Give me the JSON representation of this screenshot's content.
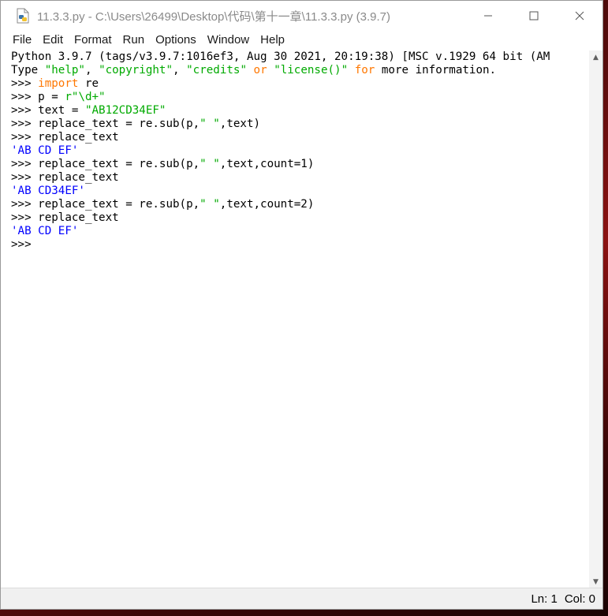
{
  "window": {
    "title": "11.3.3.py - C:\\Users\\26499\\Desktop\\代码\\第十一章\\11.3.3.py (3.9.7)"
  },
  "menu": [
    "File",
    "Edit",
    "Format",
    "Run",
    "Options",
    "Window",
    "Help"
  ],
  "shell_lines": [
    [
      {
        "t": "Python 3.9.7 (tags/v3.9.7:1016ef3, Aug 30 2021, 20:19:38) [MSC v.1929 64 bit (AM",
        "c": ""
      }
    ],
    [
      {
        "t": "Type ",
        "c": ""
      },
      {
        "t": "\"help\"",
        "c": "str"
      },
      {
        "t": ", ",
        "c": ""
      },
      {
        "t": "\"copyright\"",
        "c": "str"
      },
      {
        "t": ", ",
        "c": ""
      },
      {
        "t": "\"credits\"",
        "c": "str"
      },
      {
        "t": " ",
        "c": ""
      },
      {
        "t": "or",
        "c": "kw"
      },
      {
        "t": " ",
        "c": ""
      },
      {
        "t": "\"license()\"",
        "c": "str"
      },
      {
        "t": " ",
        "c": ""
      },
      {
        "t": "for",
        "c": "kw"
      },
      {
        "t": " more information.",
        "c": ""
      }
    ],
    [
      {
        "t": ">>> ",
        "c": ""
      },
      {
        "t": "import",
        "c": "kw"
      },
      {
        "t": " re",
        "c": ""
      }
    ],
    [
      {
        "t": ">>> p = ",
        "c": ""
      },
      {
        "t": "r\"\\d+\"",
        "c": "str"
      }
    ],
    [
      {
        "t": ">>> text = ",
        "c": ""
      },
      {
        "t": "\"AB12CD34EF\"",
        "c": "str"
      }
    ],
    [
      {
        "t": ">>> replace_text = re.sub(p,",
        "c": ""
      },
      {
        "t": "\" \"",
        "c": "str"
      },
      {
        "t": ",text)",
        "c": ""
      }
    ],
    [
      {
        "t": ">>> replace_text",
        "c": ""
      }
    ],
    [
      {
        "t": "'AB CD EF'",
        "c": "out"
      }
    ],
    [
      {
        "t": ">>> replace_text = re.sub(p,",
        "c": ""
      },
      {
        "t": "\" \"",
        "c": "str"
      },
      {
        "t": ",text,count=1)",
        "c": ""
      }
    ],
    [
      {
        "t": ">>> replace_text",
        "c": ""
      }
    ],
    [
      {
        "t": "'AB CD34EF'",
        "c": "out"
      }
    ],
    [
      {
        "t": ">>> replace_text = re.sub(p,",
        "c": ""
      },
      {
        "t": "\" \"",
        "c": "str"
      },
      {
        "t": ",text,count=2)",
        "c": ""
      }
    ],
    [
      {
        "t": ">>> replace_text",
        "c": ""
      }
    ],
    [
      {
        "t": "'AB CD EF'",
        "c": "out"
      }
    ],
    [
      {
        "t": ">>> ",
        "c": ""
      }
    ]
  ],
  "status": {
    "line": "Ln: 1",
    "col": "Col: 0"
  },
  "colors": {
    "keyword": "#ff7700",
    "string": "#00aa00",
    "output": "#0000ff"
  },
  "icons": {
    "app": "python-file-icon",
    "minimize": "minimize-icon",
    "maximize": "maximize-icon",
    "close": "close-icon"
  }
}
